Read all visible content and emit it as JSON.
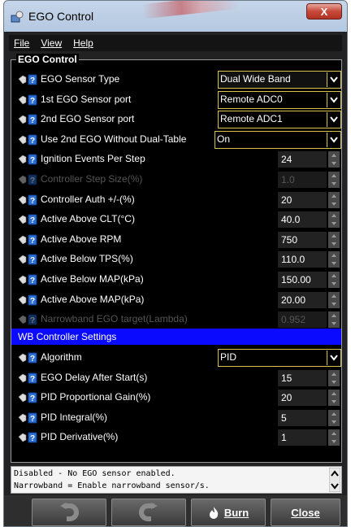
{
  "window": {
    "title": "EGO Control",
    "close_glyph": "X"
  },
  "menubar": {
    "file": "File",
    "view": "View",
    "help": "Help"
  },
  "panel": {
    "title": "EGO Control"
  },
  "rows": [
    {
      "label": "EGO Sensor Type",
      "value": "Dual Wide Band",
      "type": "combo"
    },
    {
      "label": "1st EGO Sensor port",
      "value": "Remote ADC0",
      "type": "combo"
    },
    {
      "label": "2nd EGO Sensor port",
      "value": "Remote ADC1",
      "type": "combo"
    },
    {
      "label": "Use 2nd EGO Without Dual-Table",
      "value": "On",
      "type": "combo"
    },
    {
      "label": "Ignition Events Per Step",
      "value": "24",
      "type": "spin"
    },
    {
      "label": "Controller Step Size(%)",
      "value": "1.0",
      "type": "spin",
      "disabled": true
    },
    {
      "label": "Controller Auth +/-(%)",
      "value": "20",
      "type": "spin"
    },
    {
      "label": "Active Above CLT(°C)",
      "value": "40.0",
      "type": "spin"
    },
    {
      "label": "Active Above RPM",
      "value": "750",
      "type": "spin"
    },
    {
      "label": "Active Below TPS(%)",
      "value": "110.0",
      "type": "spin"
    },
    {
      "label": "Active Below MAP(kPa)",
      "value": "150.00",
      "type": "spin"
    },
    {
      "label": "Active Above MAP(kPa)",
      "value": "20.00",
      "type": "spin"
    },
    {
      "label": "Narrowband EGO target(Lambda)",
      "value": "0.952",
      "type": "spin",
      "disabled": true
    }
  ],
  "section2": {
    "title": "WB Controller Settings"
  },
  "rows2": [
    {
      "label": "Algorithm",
      "value": "PID",
      "type": "combo"
    },
    {
      "label": "EGO Delay After Start(s)",
      "value": "15",
      "type": "spin"
    },
    {
      "label": "PID Proportional Gain(%)",
      "value": "20",
      "type": "spin"
    },
    {
      "label": "PID Integral(%)",
      "value": "5",
      "type": "spin"
    },
    {
      "label": "PID Derivative(%)",
      "value": "1",
      "type": "spin"
    }
  ],
  "status": {
    "line1": "Disabled - No EGO sensor enabled.",
    "line2": "Narrowband = Enable narrowband sensor/s."
  },
  "footer": {
    "burn": "Burn",
    "close": "Close"
  },
  "colors": {
    "section_bg": "#0a0aff",
    "combo_border": "#d6c44a",
    "panel_bg": "#000000"
  }
}
